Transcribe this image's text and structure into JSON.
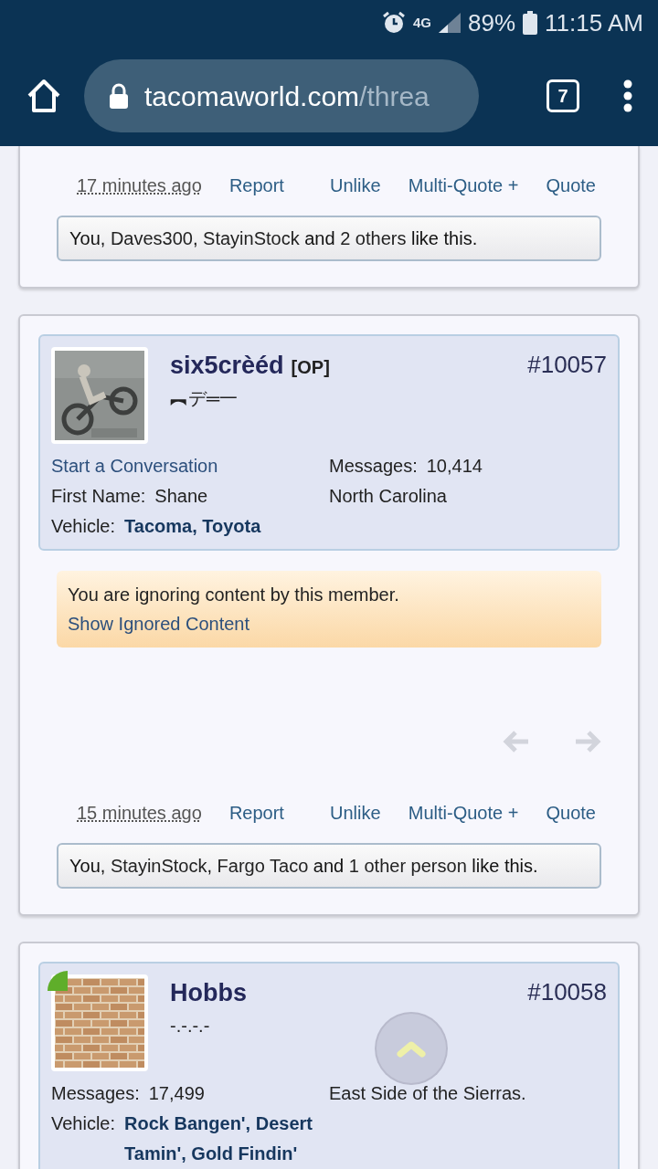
{
  "status_bar": {
    "network": "4G",
    "battery": "89%",
    "time": "11:15 AM"
  },
  "browser": {
    "url_host": "tacomaworld.com",
    "url_path": "/threa",
    "tab_count": "7"
  },
  "posts": [
    {
      "kind": "partial",
      "time": "17 minutes ago",
      "actions": [
        "Report",
        "Unlike",
        "Multi-Quote +",
        "Quote"
      ],
      "likes": {
        "lead": "You, ",
        "names": [
          "Daves300",
          "StayinStock"
        ],
        "separator": ", ",
        "joiner": " and ",
        "others": "2 others",
        "tail": " like this."
      }
    },
    {
      "kind": "ignored",
      "user": {
        "name": "six5crèéd",
        "badge": "[OP]",
        "title": "︻デ═一",
        "number": "#10057",
        "online": false
      },
      "left": [
        {
          "kind": "link",
          "text": "Start a Conversation"
        },
        {
          "kind": "pair",
          "label": "First Name:",
          "value": "Shane",
          "value_link": false
        },
        {
          "kind": "pair",
          "label": "Vehicle:",
          "value": "Tacoma, Toyota",
          "value_link": true
        }
      ],
      "right": [
        {
          "kind": "pair",
          "label": "Messages:",
          "value": "10,414",
          "value_link": false
        },
        {
          "kind": "plain",
          "text": "North Carolina"
        }
      ],
      "notice": {
        "text": "You are ignoring content by this member.",
        "link": "Show Ignored Content"
      },
      "time": "15 minutes ago",
      "actions": [
        "Report",
        "Unlike",
        "Multi-Quote +",
        "Quote"
      ],
      "likes": {
        "lead": "You, ",
        "names": [
          "StayinStock",
          "Fargo Taco"
        ],
        "separator": ", ",
        "joiner": " and ",
        "others": "1 other person",
        "tail": " like this."
      }
    },
    {
      "kind": "header",
      "user": {
        "name": "Hobbs",
        "title": "-.-.-.-",
        "number": "#10058",
        "online": true
      },
      "left": [
        {
          "kind": "pair",
          "label": "Messages:",
          "value": "17,499",
          "value_link": false
        },
        {
          "kind": "pair",
          "label": "Vehicle:",
          "value": "Rock Bangen', Desert Tamin', Gold Findin'",
          "value_link": true
        }
      ],
      "right": [
        {
          "kind": "plain",
          "text": "East Side of the Sierras."
        }
      ]
    }
  ]
}
